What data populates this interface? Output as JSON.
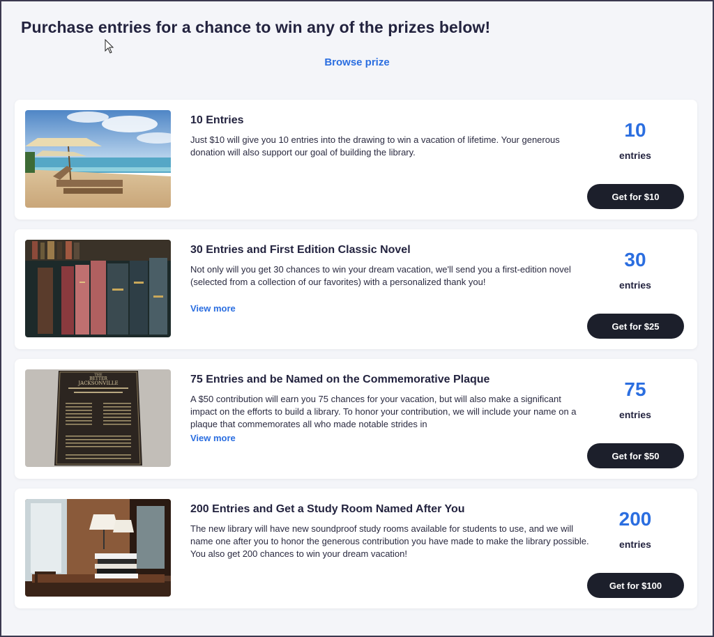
{
  "header": {
    "title": "Purchase entries for a chance to win any of the prizes below!",
    "browse_link": "Browse prize"
  },
  "packages": [
    {
      "title": "10 Entries",
      "description": "Just $10 will give you 10 entries into the drawing to win a vacation of lifetime. Your generous donation will also support our goal of building the library.",
      "view_more": "",
      "count": "10",
      "count_label": "entries",
      "button": "Get for $10",
      "image": "beach-umbrella-photo"
    },
    {
      "title": "30 Entries and First Edition Classic Novel",
      "description": "Not only will you get 30 chances to win your dream vacation, we'll send you a first-edition novel (selected from a collection of our favorites) with a personalized thank you!",
      "view_more": "View more",
      "count": "30",
      "count_label": "entries",
      "button": "Get for $25",
      "image": "old-books-photo"
    },
    {
      "title": "75 Entries and be Named on the Commemorative Plaque",
      "description": "A $50 contribution will earn you 75 chances for your vacation, but will also make a significant impact on the efforts to build a library. To honor your contribution, we will include your name on a plaque that commemorates all who made notable strides in",
      "view_more": "View more",
      "count": "75",
      "count_label": "entries",
      "button": "Get for $50",
      "image": "commemorative-plaque-photo",
      "plaque_text": [
        "THE",
        "BETTER",
        "JACKSONVILLE"
      ]
    },
    {
      "title": "200 Entries and Get a Study Room Named After You",
      "description": "The new library will have new soundproof study rooms available for students to use, and we will name one after you to honor the generous contribution you have made to make the library possible. You also get 200 chances to win your dream vacation!",
      "view_more": "",
      "count": "200",
      "count_label": "entries",
      "button": "Get for $100",
      "image": "study-room-photo"
    }
  ],
  "colors": {
    "accent": "#2b6ee0",
    "button_bg": "#1c1f2b",
    "page_bg": "#f4f5f9"
  }
}
